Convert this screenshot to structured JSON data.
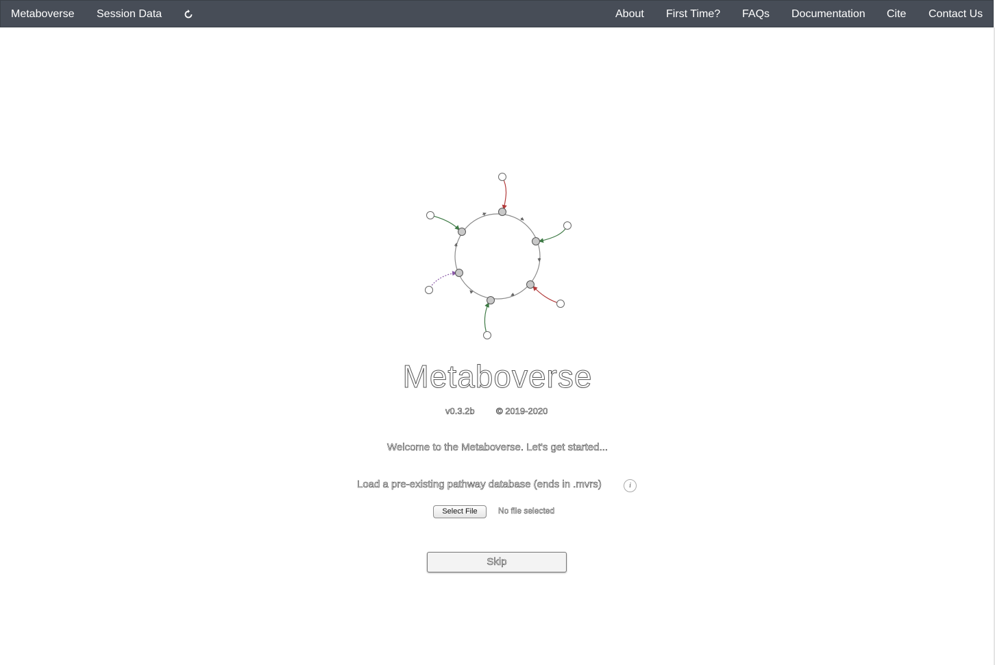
{
  "navbar": {
    "brand": "Metaboverse",
    "left_items": [
      "Session Data"
    ],
    "refresh_icon": "refresh-icon",
    "right_items": [
      "About",
      "First Time?",
      "FAQs",
      "Documentation",
      "Cite",
      "Contact Us"
    ],
    "background": "#474d57"
  },
  "main": {
    "title": "Metaboverse",
    "version": "v0.3.2b",
    "copyright": "© 2019-2020",
    "welcome": "Welcome to the Metaboverse. Let's get started...",
    "load_label": "Load a pre-existing pathway database (ends in .mvrs)",
    "info_icon": "i",
    "file_button": "Select File",
    "file_status": "No file selected",
    "skip_button": "Skip"
  }
}
